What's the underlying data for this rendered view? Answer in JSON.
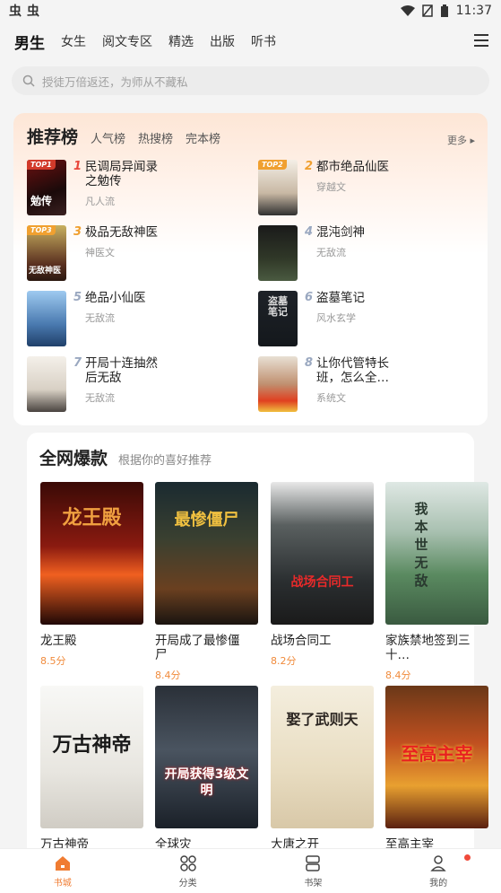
{
  "status": {
    "left_icons": [
      "虫",
      "虫"
    ],
    "time": "11:37"
  },
  "nav": {
    "tabs": [
      "男生",
      "女生",
      "阅文专区",
      "精选",
      "出版",
      "听书"
    ]
  },
  "search": {
    "placeholder": "授徒万倍返还，为师从不藏私"
  },
  "ranking": {
    "title": "推荐榜",
    "subtabs": [
      "人气榜",
      "热搜榜",
      "完本榜"
    ],
    "more": "更多",
    "items": [
      {
        "num": "1",
        "tag": "TOP1",
        "name": "民调局异闻录之勉传",
        "genre": "凡人流",
        "cover_text": "勉传"
      },
      {
        "num": "2",
        "tag": "TOP2",
        "name": "都市绝品仙医",
        "genre": "穿越文",
        "cover_text": ""
      },
      {
        "num": "3",
        "tag": "TOP3",
        "name": "极品无敌神医",
        "genre": "神医文",
        "cover_text": "无敌神医"
      },
      {
        "num": "4",
        "tag": "",
        "name": "混沌剑神",
        "genre": "无敌流",
        "cover_text": ""
      },
      {
        "num": "5",
        "tag": "",
        "name": "绝品小仙医",
        "genre": "无敌流",
        "cover_text": ""
      },
      {
        "num": "6",
        "tag": "",
        "name": "盗墓笔记",
        "genre": "风水玄学",
        "cover_text": "盗墓笔记"
      },
      {
        "num": "7",
        "tag": "",
        "name": "开局十连抽然后无敌",
        "genre": "无敌流",
        "cover_text": ""
      },
      {
        "num": "8",
        "tag": "",
        "name": "让你代管特长班，怎么全…",
        "genre": "系统文",
        "cover_text": ""
      }
    ]
  },
  "hot": {
    "title": "全网爆款",
    "subtitle": "根据你的喜好推荐",
    "books": [
      {
        "name": "龙王殿",
        "score": "8.5分",
        "cover_text": "龙王殿"
      },
      {
        "name": "开局成了最惨僵尸",
        "score": "8.4分",
        "cover_text": "最惨僵尸"
      },
      {
        "name": "战场合同工",
        "score": "8.2分",
        "cover_text": "战场合同工"
      },
      {
        "name": "家族禁地签到三十…",
        "score": "8.4分",
        "cover_text": "我本世无敌"
      },
      {
        "name": "万古神帝",
        "score": "",
        "cover_text": "万古神帝"
      },
      {
        "name": "全球灾",
        "score": "",
        "cover_text": "开局获得3级文明"
      },
      {
        "name": "大唐之开",
        "score": "",
        "cover_text": "娶了武则天"
      },
      {
        "name": "至高主宰",
        "score": "",
        "cover_text": "至高主宰"
      }
    ]
  },
  "bottombar": {
    "items": [
      "书城",
      "分类",
      "书架",
      "我的"
    ]
  }
}
